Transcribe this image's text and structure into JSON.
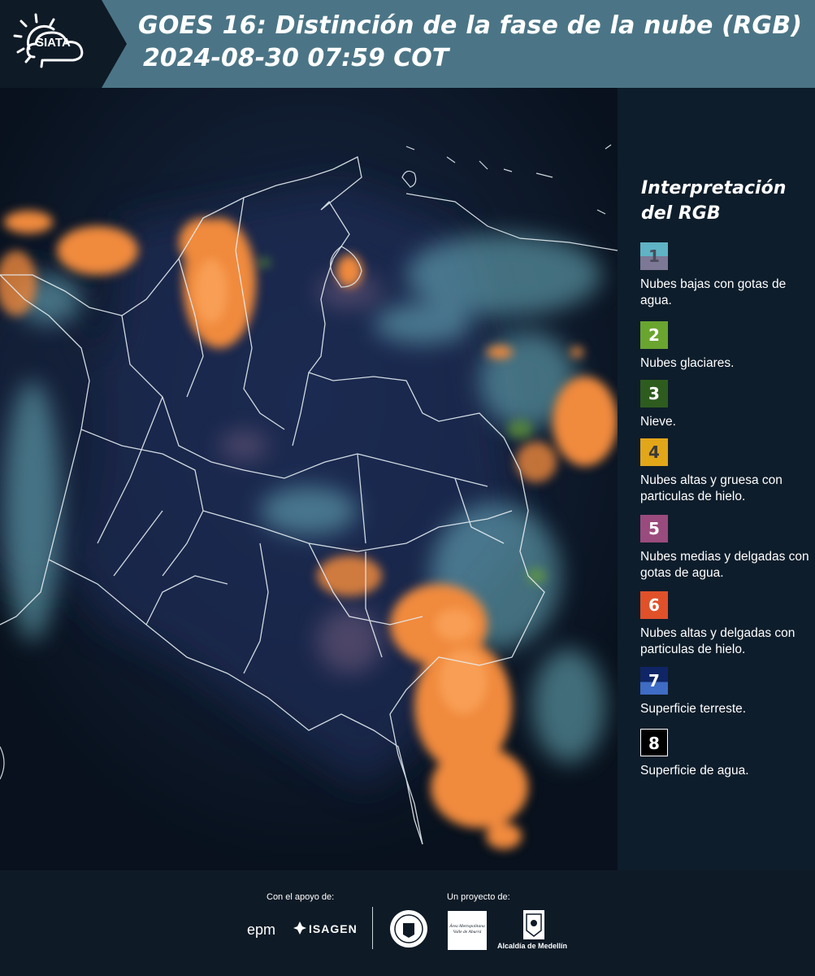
{
  "header": {
    "logo_text": "SIATA",
    "title_line1": "GOES 16: Distinción de la fase de la nube (RGB)",
    "title_line2": "2024-08-30 07:59 COT"
  },
  "legend": {
    "title_line1": "Interpretación",
    "title_line2": "del RGB",
    "items": [
      {
        "number": "1",
        "label": "Nubes bajas con gotas de agua.",
        "color_top": "#5fb3c4",
        "color_bottom": "#7c7896"
      },
      {
        "number": "2",
        "label": "Nubes glaciares.",
        "color_top": "#6aa52f",
        "color_bottom": "#6aa52f"
      },
      {
        "number": "3",
        "label": "Nieve.",
        "color_top": "#2e5c1f",
        "color_bottom": "#2e5c1f"
      },
      {
        "number": "4",
        "label": "Nubes altas y gruesa con particulas de hielo.",
        "color_top": "#e2a619",
        "color_bottom": "#e2a619"
      },
      {
        "number": "5",
        "label": "Nubes medias y delgadas con gotas de agua.",
        "color_top": "#9a4b7e",
        "color_bottom": "#9a4b7e"
      },
      {
        "number": "6",
        "label": "Nubes altas y delgadas con particulas de hielo.",
        "color_top": "#e0512a",
        "color_bottom": "#e0512a"
      },
      {
        "number": "7",
        "label": "Superficie terreste.",
        "color_top": "#0f2566",
        "color_bottom": "#3f6cc4"
      },
      {
        "number": "8",
        "label": "Superficie de agua.",
        "color_top": "#000000",
        "color_bottom": "#000000"
      }
    ]
  },
  "footer": {
    "support_label": "Con el apoyo de:",
    "project_label": "Un proyecto de:",
    "sponsor_epm": "epm",
    "sponsor_isagen": "ISAGEN",
    "area_metropolitana_logo": "Área Metropolitana Valle de Aburrá",
    "medellin_seal": "Medellín seal",
    "alcaldia": "Alcaldía de Medellín"
  },
  "colors": {
    "header_bg": "#4b7586",
    "page_bg": "#0e1a26",
    "cloud_orange": "#f08a3c",
    "cloud_cyan": "#6fb7c4"
  }
}
